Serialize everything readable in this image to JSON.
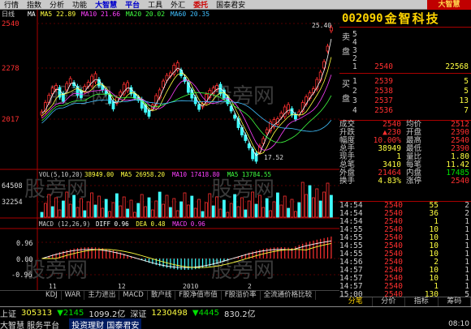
{
  "menu": {
    "items": [
      "行情",
      "指数",
      "分析",
      "功能",
      "大智慧",
      "平台",
      "工具",
      "外汇",
      "委托",
      "国泰君安"
    ],
    "brand": "大智慧"
  },
  "stock": {
    "code": "002090",
    "name": "金智科技"
  },
  "orderbook": {
    "sell_label": "卖盘",
    "buy_label": "买盘",
    "sell": [
      {
        "level": "5",
        "price": "",
        "vol": ""
      },
      {
        "level": "4",
        "price": "",
        "vol": ""
      },
      {
        "level": "3",
        "price": "",
        "vol": ""
      },
      {
        "level": "2",
        "price": "",
        "vol": ""
      },
      {
        "level": "1",
        "price": "2540",
        "vol": "22568"
      }
    ],
    "buy": [
      {
        "level": "1",
        "price": "2539",
        "vol": "5"
      },
      {
        "level": "2",
        "price": "2538",
        "vol": "5"
      },
      {
        "level": "3",
        "price": "2537",
        "vol": "13"
      },
      {
        "level": "4",
        "price": "2536",
        "vol": "7"
      }
    ]
  },
  "quote": [
    {
      "k": "成交",
      "v": "2540",
      "vc": "up",
      "k2": "均价",
      "v2": "2512",
      "v2c": "up"
    },
    {
      "k": "升跌",
      "v": "▲230",
      "vc": "up",
      "k2": "开盘",
      "v2": "2390",
      "v2c": "up"
    },
    {
      "k": "幅度",
      "v": "10.00%",
      "vc": "up",
      "k2": "最高",
      "v2": "2540",
      "v2c": "up"
    },
    {
      "k": "总手",
      "v": "38949",
      "vc": "yl",
      "k2": "最低",
      "v2": "2390",
      "v2c": "up"
    },
    {
      "k": "现手",
      "v": "1",
      "vc": "yl",
      "k2": "量比",
      "v2": "1.80",
      "v2c": "yl"
    },
    {
      "k": "总笔",
      "v": "3410",
      "vc": "yl",
      "k2": "每笔",
      "v2": "11.42",
      "v2c": "yl"
    },
    {
      "k": "外盘",
      "v": "21464",
      "vc": "up",
      "k2": "内盘",
      "v2": "17485",
      "v2c": "dn"
    },
    {
      "k": "换手",
      "v": "4.83%",
      "vc": "yl",
      "k2": "涨停",
      "v2": "2540",
      "v2c": "up"
    }
  ],
  "ticks": [
    {
      "t": "14:54",
      "p": "2540",
      "v": "55",
      "n": "2"
    },
    {
      "t": "14:54",
      "p": "2540",
      "v": "36",
      "n": "2"
    },
    {
      "t": "14:54",
      "p": "2540",
      "v": "1",
      "n": "1"
    },
    {
      "t": "14:55",
      "p": "2540",
      "v": "10",
      "n": "1"
    },
    {
      "t": "14:55",
      "p": "2540",
      "v": "10",
      "n": "1"
    },
    {
      "t": "14:55",
      "p": "2540",
      "v": "10",
      "n": "1"
    },
    {
      "t": "14:55",
      "p": "2540",
      "v": "10",
      "n": "1"
    },
    {
      "t": "14:56",
      "p": "2540",
      "v": "2",
      "n": "1"
    },
    {
      "t": "14:57",
      "p": "2540",
      "v": "10",
      "n": "1"
    },
    {
      "t": "14:57",
      "p": "2540",
      "v": "10",
      "n": "1"
    },
    {
      "t": "14:57",
      "p": "2540",
      "v": "1",
      "n": "1"
    },
    {
      "t": "15:00",
      "p": "2540",
      "v": "130",
      "n": "5"
    }
  ],
  "side_tabs": [
    "分笔",
    "分价",
    "指标",
    "筹码"
  ],
  "chart": {
    "period": "日线",
    "ma_legend": [
      {
        "label": "MA",
        "color": "#ffffff"
      },
      {
        "label": "MA5 22.89",
        "color": "#ffff40"
      },
      {
        "label": "MA10 21.66",
        "color": "#ff40ff"
      },
      {
        "label": "MA20 20.02",
        "color": "#40ff40"
      },
      {
        "label": "MA60 20.35",
        "color": "#40c0ff"
      }
    ],
    "price_ticks": [
      "2540",
      "2278",
      "2017"
    ],
    "high_label": "25.40",
    "low_label": "17.52",
    "vol_legend": "VOL(5,10,20)",
    "vol_values": [
      {
        "label": "38949.00",
        "color": "#ffff40"
      },
      {
        "label": "MA5 26958.20",
        "color": "#ffff40"
      },
      {
        "label": "MA10 17418.80",
        "color": "#ff40ff"
      },
      {
        "label": "MA5 13784.55",
        "color": "#40ff40"
      }
    ],
    "vol_ticks": [
      "64508",
      "32254"
    ],
    "macd_legend": "MACD (12,26,9)",
    "macd_values": [
      {
        "label": "DIFF 0.96",
        "color": "#ffffff"
      },
      {
        "label": "DEA 0.48",
        "color": "#ffff40"
      },
      {
        "label": "MACD 0.96",
        "color": "#ff40ff"
      }
    ],
    "macd_ticks": [
      "0.96",
      "0.00",
      "-0.96"
    ],
    "x_labels": [
      "11",
      "12",
      "2010",
      "2"
    ],
    "watermark": "股旁网"
  },
  "indicator_tabs": [
    "KDJ",
    "WAR",
    "主力进出",
    "MACD",
    "散户线",
    "F股净值市值",
    "F股溢价率",
    "全流通价格比较"
  ],
  "status": {
    "row1": [
      {
        "t": "上证",
        "c": "wh"
      },
      {
        "t": "305313",
        "c": "yl"
      },
      {
        "t": "▼2145",
        "c": "dn"
      },
      {
        "t": "1099.2亿",
        "c": "wh"
      },
      {
        "t": "深证",
        "c": "wh"
      },
      {
        "t": "1230498",
        "c": "yl"
      },
      {
        "t": "▼4445",
        "c": "dn"
      },
      {
        "t": "830.2亿",
        "c": "wh"
      }
    ],
    "row2": [
      {
        "t": "大智慧 服务平台",
        "c": "wh"
      }
    ],
    "ticker": "投资理财  国泰君安",
    "clock": "08:10"
  }
}
